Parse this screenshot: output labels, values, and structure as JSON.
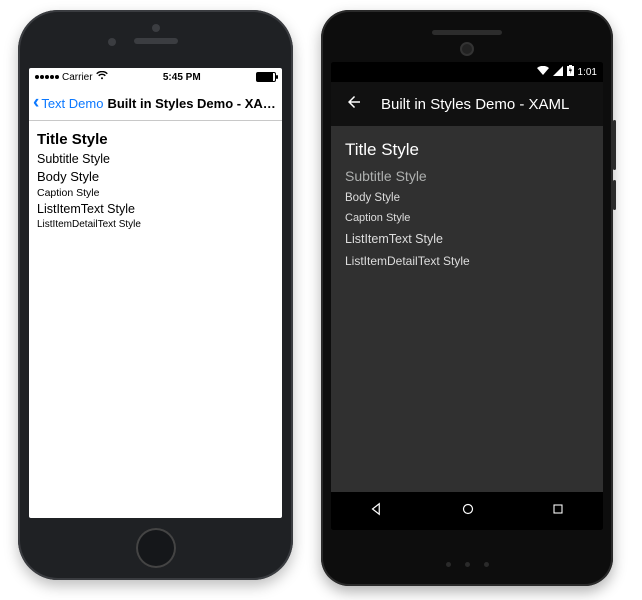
{
  "ios": {
    "status": {
      "carrier": "Carrier",
      "wifi": "wifi-icon",
      "time": "5:45 PM"
    },
    "nav": {
      "back_label": "Text Demo",
      "title": "Built in Styles Demo - XAML"
    },
    "styles": {
      "title": "Title Style",
      "subtitle": "Subtitle Style",
      "body": "Body Style",
      "caption": "Caption Style",
      "listitem": "ListItemText Style",
      "listdetail": "ListItemDetailText Style"
    }
  },
  "android": {
    "status": {
      "time": "1:01"
    },
    "appbar": {
      "title": "Built in Styles Demo - XAML"
    },
    "styles": {
      "title": "Title Style",
      "subtitle": "Subtitle Style",
      "body": "Body Style",
      "caption": "Caption Style",
      "listitem": "ListItemText Style",
      "listdetail": "ListItemDetailText Style"
    }
  }
}
